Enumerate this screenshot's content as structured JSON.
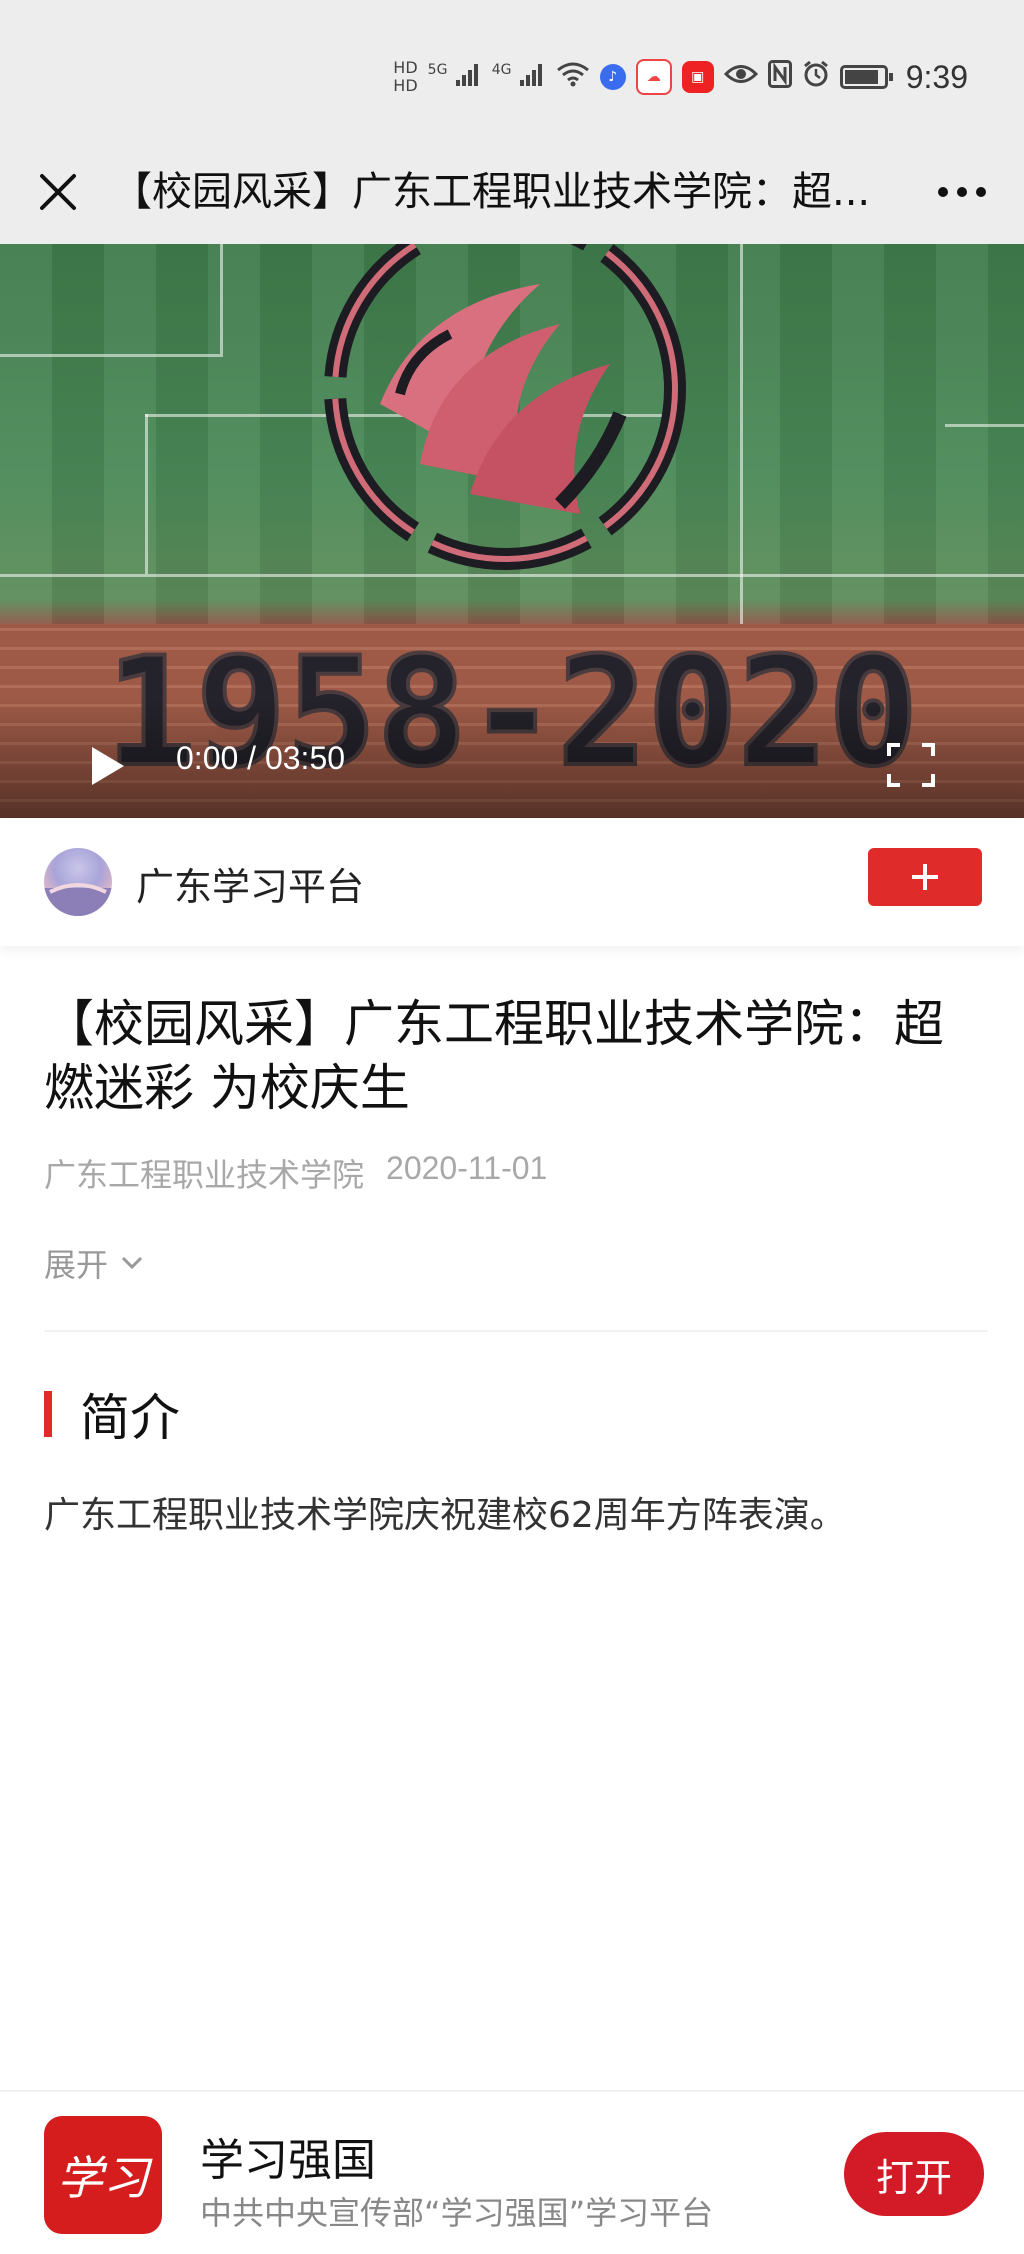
{
  "status_bar": {
    "network_1": "HD",
    "network_2": "HD",
    "signal_1": "5G",
    "signal_2": "4G",
    "time": "9:39"
  },
  "nav": {
    "title": "【校园风采】广东工程职业技术学院：超..."
  },
  "video": {
    "time": "0:00 / 03:50",
    "years_text": "1958-2020"
  },
  "author": {
    "name": "广东学习平台",
    "follow_symbol": "+"
  },
  "article": {
    "title": "【校园风采】广东工程职业技术学院：超燃迷彩 为校庆生",
    "source": "广东工程职业技术学院",
    "date": "2020-11-01",
    "expand_label": "展开"
  },
  "section": {
    "title": "简介",
    "summary": "广东工程职业技术学院庆祝建校62周年方阵表演。"
  },
  "banner": {
    "logo_text": "学习",
    "app_name": "学习强国",
    "app_desc": "中共中央宣传部“学习强国”学习平台",
    "open_label": "打开"
  },
  "colors": {
    "accent": "#e02b2b",
    "open_button": "#d31b27",
    "status_bg": "#ededed"
  }
}
